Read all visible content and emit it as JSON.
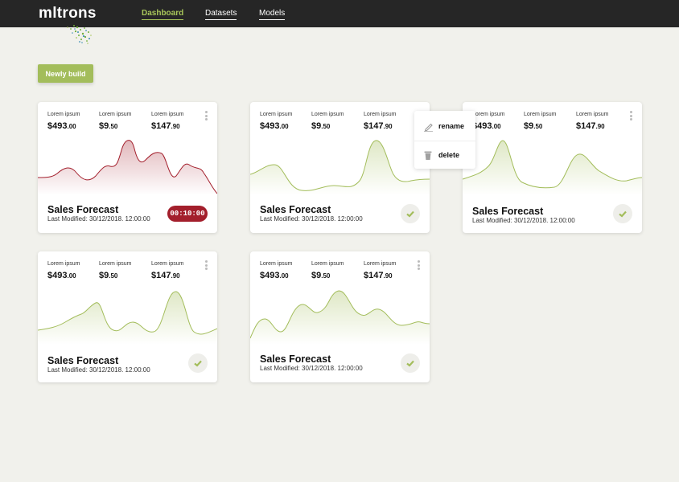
{
  "brand": {
    "logo_text": "mltrons"
  },
  "nav": [
    {
      "label": "Dashboard",
      "active": true
    },
    {
      "label": "Datasets",
      "active": false
    },
    {
      "label": "Models",
      "active": false
    }
  ],
  "toolbar": {
    "new_button_label": "Newly build"
  },
  "context_menu": {
    "items": [
      {
        "label": "rename",
        "icon": "pen-icon"
      },
      {
        "label": "delete",
        "icon": "trash-icon"
      }
    ]
  },
  "colors": {
    "accent": "#a3bd5b",
    "alert": "#a31f2c",
    "topbar": "#262626",
    "background": "#f1f1ec"
  },
  "cards": [
    {
      "stats": [
        {
          "label": "Lorem ipsum",
          "value": "$493",
          "cents": ".00"
        },
        {
          "label": "Lorem ipsum",
          "value": "$9",
          "cents": ".50"
        },
        {
          "label": "Lorem ipsum",
          "value": "$147",
          "cents": ".90"
        }
      ],
      "title": "Sales Forecast",
      "modified": "Last Modified: 30/12/2018. 12:00:00",
      "status": "running",
      "timer": "00:10:00",
      "chart_color": "#a31f2c"
    },
    {
      "stats": [
        {
          "label": "Lorem ipsum",
          "value": "$493",
          "cents": ".00"
        },
        {
          "label": "Lorem ipsum",
          "value": "$9",
          "cents": ".50"
        },
        {
          "label": "Lorem ipsum",
          "value": "$147",
          "cents": ".90"
        }
      ],
      "title": "Sales Forecast",
      "modified": "Last Modified: 30/12/2018. 12:00:00",
      "status": "done",
      "chart_color": "#a3bd5b"
    },
    {
      "stats": [
        {
          "label": "Lorem ipsum",
          "value": "$493",
          "cents": ".00"
        },
        {
          "label": "Lorem ipsum",
          "value": "$9",
          "cents": ".50"
        },
        {
          "label": "Lorem ipsum",
          "value": "$147",
          "cents": ".90"
        }
      ],
      "title": "Sales Forecast",
      "modified": "Last Modified: 30/12/2018. 12:00:00",
      "status": "done",
      "chart_color": "#a3bd5b"
    },
    {
      "stats": [
        {
          "label": "Lorem ipsum",
          "value": "$493",
          "cents": ".00"
        },
        {
          "label": "Lorem ipsum",
          "value": "$9",
          "cents": ".50"
        },
        {
          "label": "Lorem ipsum",
          "value": "$147",
          "cents": ".90"
        }
      ],
      "title": "Sales Forecast",
      "modified": "Last Modified: 30/12/2018. 12:00:00",
      "status": "done",
      "chart_color": "#a3bd5b"
    },
    {
      "stats": [
        {
          "label": "Lorem ipsum",
          "value": "$493",
          "cents": ".00"
        },
        {
          "label": "Lorem ipsum",
          "value": "$9",
          "cents": ".50"
        },
        {
          "label": "Lorem ipsum",
          "value": "$147",
          "cents": ".90"
        }
      ],
      "title": "Sales Forecast",
      "modified": "Last Modified: 30/12/2018. 12:00:00",
      "status": "done",
      "chart_color": "#a3bd5b"
    }
  ]
}
